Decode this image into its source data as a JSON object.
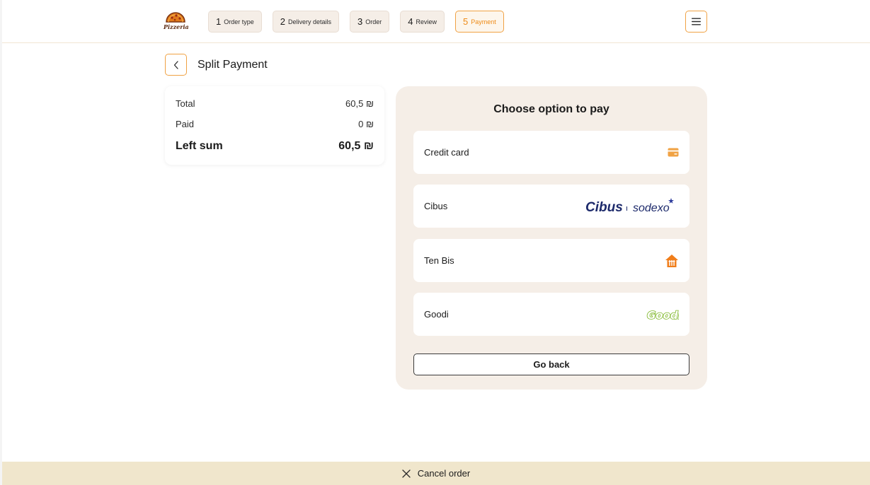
{
  "header": {
    "logo_text": "Pizzeria",
    "steps": [
      {
        "num": "1",
        "label": "Order type"
      },
      {
        "num": "2",
        "label": "Delivery details"
      },
      {
        "num": "3",
        "label": "Order"
      },
      {
        "num": "4",
        "label": "Review"
      },
      {
        "num": "5",
        "label": "Payment",
        "active": true
      }
    ],
    "menu_icon": "hamburger-menu-icon"
  },
  "page": {
    "title": "Split Payment",
    "back_icon": "chevron-left-icon"
  },
  "summary": {
    "total_label": "Total",
    "total_value": "60,5 ₪",
    "paid_label": "Paid",
    "paid_value": "0 ₪",
    "left_label": "Left sum",
    "left_value": "60,5 ₪"
  },
  "payment": {
    "title": "Choose option to pay",
    "options": [
      {
        "label": "Credit card",
        "icon": "credit-card-icon"
      },
      {
        "label": "Cibus",
        "icon": "cibus-sodexo-logo",
        "logo_text_1": "Cibus",
        "logo_text_2": "sodexo"
      },
      {
        "label": "Ten Bis",
        "icon": "ten-bis-logo"
      },
      {
        "label": "Goodi",
        "icon": "goodi-logo",
        "logo_text": "Goodi"
      }
    ],
    "go_back_label": "Go back"
  },
  "footer": {
    "cancel_label": "Cancel order",
    "cancel_icon": "close-icon"
  },
  "colors": {
    "accent": "#ee8b17",
    "panel_bg": "#f5eee7",
    "footer_bg": "#f0e6cc"
  }
}
